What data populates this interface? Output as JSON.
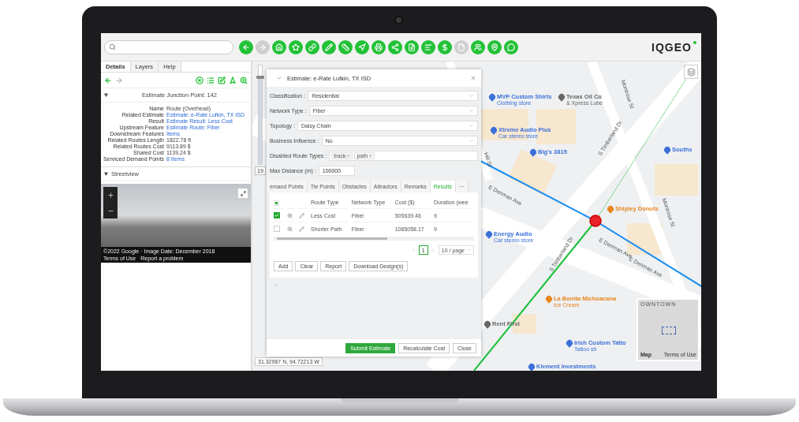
{
  "toolbar": {
    "buttons": [
      {
        "kind": "back",
        "disabled": false
      },
      {
        "kind": "forward",
        "disabled": true
      },
      {
        "kind": "home",
        "disabled": false
      },
      {
        "kind": "star",
        "disabled": false
      },
      {
        "kind": "link",
        "disabled": false
      },
      {
        "kind": "pencil",
        "disabled": false
      },
      {
        "kind": "ruler",
        "disabled": false
      },
      {
        "kind": "navigate",
        "disabled": false
      },
      {
        "kind": "print",
        "disabled": false
      },
      {
        "kind": "share",
        "disabled": false
      },
      {
        "kind": "upload",
        "disabled": false
      },
      {
        "kind": "lines",
        "disabled": false
      },
      {
        "kind": "dollar",
        "disabled": false
      },
      {
        "kind": "document",
        "disabled": true
      },
      {
        "kind": "people",
        "disabled": false
      },
      {
        "kind": "pin",
        "disabled": false
      },
      {
        "kind": "chat",
        "disabled": false
      }
    ],
    "logo": "IQGEO"
  },
  "left_panel": {
    "tabs": [
      {
        "label": "Details",
        "selected": true
      },
      {
        "label": "Layers",
        "selected": false
      },
      {
        "label": "Help",
        "selected": false
      }
    ],
    "actions": [
      {
        "kind": "back",
        "disabled": false
      },
      {
        "kind": "forward",
        "disabled": true
      },
      {
        "kind": "clear",
        "disabled": false
      },
      {
        "kind": "list",
        "disabled": false
      },
      {
        "kind": "edit",
        "disabled": false
      },
      {
        "kind": "route",
        "disabled": false
      },
      {
        "kind": "zoom",
        "disabled": false
      }
    ],
    "details": {
      "title": "Estimate Junction Point: 142",
      "expanded": true,
      "properties": [
        {
          "label": "Name",
          "value": "Route (Overhead)",
          "link": false
        },
        {
          "label": "Related Estimate",
          "value": "Estimate: e-Rate Lufkin, TX ISD",
          "link": true
        },
        {
          "label": "Result",
          "value": "Estimate Result: Less Cost",
          "link": true
        },
        {
          "label": "Upstream Feature",
          "value": "Estimate Route: Fiber",
          "link": true
        },
        {
          "label": "Downstream Features",
          "value": "Items",
          "link": true
        },
        {
          "label": "Related Routes Length",
          "value": "1822.78 ft",
          "link": false
        },
        {
          "label": "Related Routes Cost",
          "value": "9113.89 $",
          "link": false
        },
        {
          "label": "Shared Cost",
          "value": "1139.24 $",
          "link": false
        },
        {
          "label": "Serviced Demand Points",
          "value": "8 Items",
          "link": true
        }
      ]
    },
    "streetview": {
      "title": "Streetview",
      "expanded": true,
      "caption": [
        "©2022 Google · Image Date: December 2018",
        "Terms of Use",
        "Report a problem"
      ]
    }
  },
  "map": {
    "zoom": {
      "level": 0.88,
      "value": "19"
    },
    "coordinates": "31.32967 N, 94.72213 W",
    "places": [
      {
        "name": "MVP Custom Shirts",
        "sub": "Clothing store",
        "kind": "shop"
      },
      {
        "name": "Texas Oil Co",
        "sub": "& Xpress Lube",
        "kind": "place"
      },
      {
        "name": "Xtreme Audio Plus",
        "sub": "Car stereo store",
        "kind": "shop"
      },
      {
        "name": "Big's 3815",
        "kind": "shop"
      },
      {
        "name": "Shipley Donuts",
        "kind": "food"
      },
      {
        "name": "Energy Audio",
        "sub": "Car stereo store",
        "kind": "shop"
      },
      {
        "name": "La Bonita Michoacana",
        "sub": "Ice Cream",
        "kind": "food"
      },
      {
        "name": "Rent First",
        "kind": "place"
      },
      {
        "name": "Irish Custom Tatto",
        "sub": "Tattoo sh",
        "kind": "shop"
      },
      {
        "name": "Klement Investments",
        "kind": "shop"
      },
      {
        "name": "Souths",
        "kind": "shop"
      }
    ],
    "streets": [
      "E Denman Ave",
      "S Timberland Dr",
      "Montrose St",
      "E Denman Ave",
      "S Timberland Dr",
      "E Denman Ave",
      "Montrose St",
      "Hill St"
    ],
    "overview": {
      "label": "OWNTOWN",
      "brand": "Map",
      "terms": "Terms of Use"
    }
  },
  "dialog": {
    "title": "Estimate: e-Rate Lufkin, TX ISD",
    "fields": [
      {
        "kind": "select",
        "label": "Classification :",
        "value": "Residential"
      },
      {
        "kind": "select",
        "label": "Network Type :",
        "value": "Fiber"
      },
      {
        "kind": "select",
        "label": "Topology :",
        "value": "Daisy Chain"
      },
      {
        "kind": "select",
        "label": "Business Influence :",
        "value": "No"
      },
      {
        "kind": "tags",
        "label": "Disabled Route Types :",
        "tags": [
          "track",
          "path"
        ]
      },
      {
        "kind": "input",
        "label": "Max Distance (m) :",
        "value": "100000"
      }
    ],
    "tabs": [
      {
        "label": "emand Points",
        "selected": false
      },
      {
        "label": "Tie Points",
        "selected": false
      },
      {
        "label": "Obstacles",
        "selected": false
      },
      {
        "label": "Attractors",
        "selected": false
      },
      {
        "label": "Remarks",
        "selected": false
      },
      {
        "label": "Results",
        "selected": true
      },
      {
        "label": "···",
        "selected": false
      }
    ],
    "table": {
      "select_all": {
        "indeterminate": true
      },
      "columns": [
        "Route Type",
        "Network Type",
        "Cost ($)",
        "Duration (wee"
      ],
      "rows": [
        {
          "checked": true,
          "cells": [
            "Less Cost",
            "Fiber",
            "505639.46",
            "9"
          ]
        },
        {
          "checked": false,
          "cells": [
            "Shorter Path",
            "Fiber",
            "1085058.17",
            "9"
          ]
        }
      ]
    },
    "pagination": {
      "page": "1",
      "size": "10 / page"
    },
    "actions": [
      "Add",
      "Clear",
      "Report",
      "Download Design(s)"
    ],
    "footer": [
      {
        "label": "Submit Estimate",
        "primary": true
      },
      {
        "label": "Recalculate Cost",
        "primary": false
      },
      {
        "label": "Close",
        "primary": false
      }
    ]
  }
}
